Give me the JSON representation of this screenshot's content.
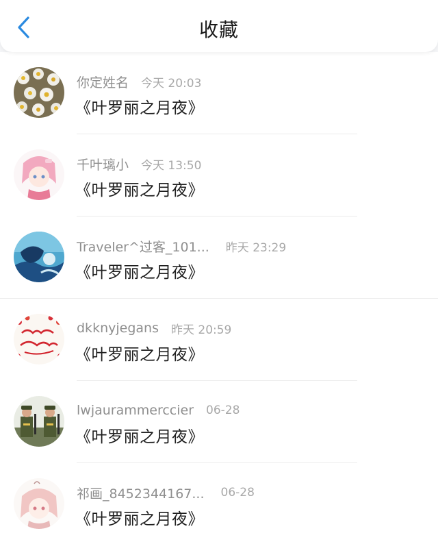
{
  "header": {
    "title": "收藏",
    "back_icon": "chevron-left-icon",
    "accent": "#2b8ae0"
  },
  "favorites": [
    {
      "username": "你定姓名",
      "time": "今天 20:03",
      "book": "《叶罗丽之月夜》",
      "avatar": "daisy-flowers"
    },
    {
      "username": "千叶璃小",
      "time": "今天 13:50",
      "book": "《叶罗丽之月夜》",
      "avatar": "anime-girl-pink"
    },
    {
      "username": "Traveler^过客_101...",
      "time": "昨天 23:29",
      "book": "《叶罗丽之月夜》",
      "avatar": "anime-blue-water"
    },
    {
      "username": "dkknyjegans",
      "time": "昨天 20:59",
      "book": "《叶罗丽之月夜》",
      "avatar": "happy-birthday-cake"
    },
    {
      "username": "lwjaurammerccier",
      "time": "06-28",
      "book": "《叶罗丽之月夜》",
      "avatar": "soldiers"
    },
    {
      "username": "祁画_8452344167...",
      "time": "06-28",
      "book": "《叶罗丽之月夜》",
      "avatar": "anime-girl-sketch"
    }
  ]
}
